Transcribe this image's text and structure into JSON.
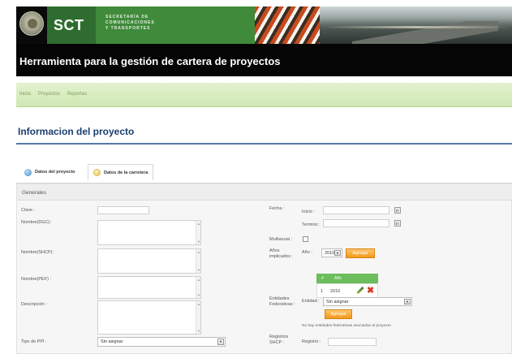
{
  "header": {
    "logo": "SCT",
    "secretaria_lines": [
      "SECRETARÍA DE",
      "COMUNICACIONES",
      "Y TRANSPORTES"
    ],
    "app_title": "Herramienta para la gestión de cartera de proyectos"
  },
  "nav": {
    "items": [
      "Inicio",
      "Proyectos",
      "Reportes"
    ]
  },
  "page": {
    "section_title": "Informacion del proyecto",
    "tabs": [
      "Datos del proyecto",
      "Datos de la carretera"
    ],
    "panel_title": "Generales"
  },
  "form": {
    "clave_label": "Clave :",
    "nombre_dgc_label": "Nombre(DGC):",
    "nombre_shcp_label": "Nombre(SHCP):",
    "nombre_pef_label": "Nombre(PEF) :",
    "descripcion_label": "Descripción :",
    "tipo_ppi_label": "Tipo de PPI :",
    "tipo_ppi_value": "Sin asignar",
    "fecha_label": "Fecha :",
    "inicio_label": "Inicio :",
    "termino_label": "Termino :",
    "multianual_label": "Multianual :",
    "anios_label_1": "Años",
    "anios_label_2": "implicados :",
    "anio_label": "Año :",
    "anio_value": "2010",
    "agregar_label": "Agregar",
    "grid_head_num": "#",
    "grid_head_anio": "Año",
    "grid_row_num": "1",
    "grid_row_anio": "2010",
    "entidades_label_1": "Entidades",
    "entidades_label_2": "Federativas :",
    "entidad_label": "Entidad :",
    "entidad_value": "Sin asignar",
    "entidades_note": "No hay entidades federativas asociadas al proyecto",
    "registros_label_1": "Registros",
    "registros_label_2": "SHCP :",
    "registro_label": "Registro :"
  },
  "colors": {
    "title_blue": "#1a3f70",
    "accent_green": "#3f8a3b",
    "nav_green": "#cfe8b3",
    "button_orange": "#f39a1a",
    "grid_green": "#6cbd5c"
  },
  "icons": [
    "seal-icon",
    "info-tab-icon",
    "road-tab-icon",
    "calendar-icon",
    "dropdown-arrow-icon",
    "edit-icon",
    "delete-icon"
  ]
}
